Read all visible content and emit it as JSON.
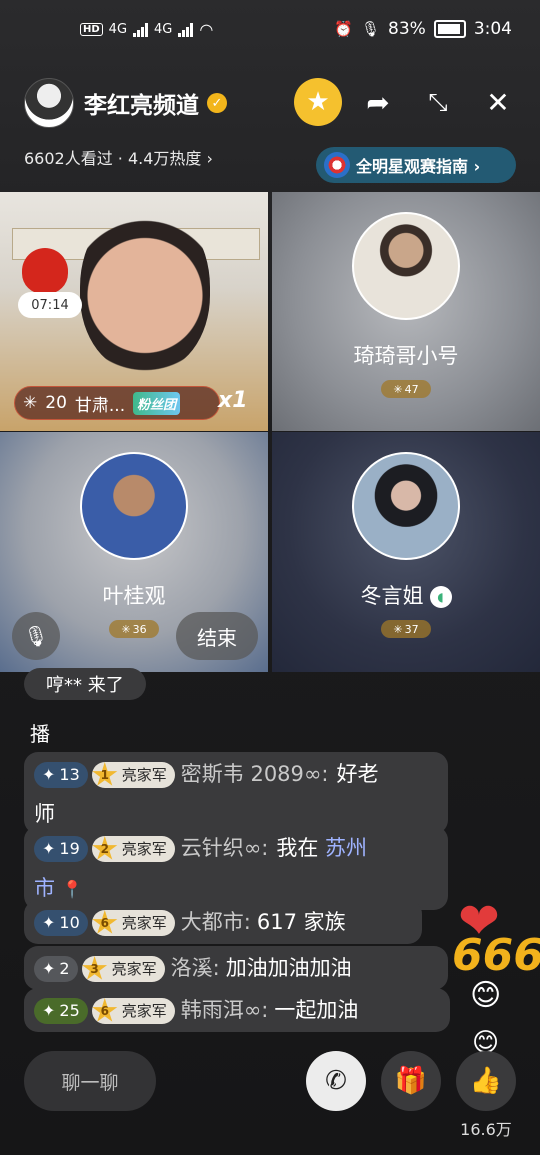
{
  "status": {
    "network": "HD",
    "sim1": "4G",
    "sim2": "4G",
    "battery": "83%",
    "time": "3:04"
  },
  "header": {
    "host_name": "李红亮频道",
    "stats": "6602人看过 · 4.4万热度 ›",
    "guide": "全明星观赛指南 ›"
  },
  "tiles": [
    {
      "timer": "07:14",
      "badge_level": "20",
      "user": "甘肃...",
      "fans_label": "粉丝团",
      "multiplier": "x1"
    },
    {
      "name": "琦琦哥小号",
      "heat": "47"
    },
    {
      "name": "叶桂观",
      "heat": "36",
      "end_label": "结束"
    },
    {
      "name": "冬言姐",
      "heat": "37"
    }
  ],
  "chat": {
    "join_text": "哼** 来了",
    "partial": "播",
    "messages": [
      {
        "level": "13",
        "fan_level": "1",
        "fan_name": "亮家军",
        "user": "密斯韦 2089∞:",
        "text1": "好老",
        "text2": "师"
      },
      {
        "level": "19",
        "fan_level": "2",
        "fan_name": "亮家军",
        "user": "云针织∞:",
        "text1": "我在",
        "link1": "苏州",
        "link2": "市"
      },
      {
        "level": "10",
        "fan_level": "6",
        "fan_name": "亮家军",
        "user": "大都市:",
        "text": "617 家族"
      },
      {
        "level": "2",
        "fan_level": "3",
        "fan_name": "亮家军",
        "user": "洛溪:",
        "text": "加油加油加油"
      },
      {
        "level": "25",
        "fan_level": "6",
        "fan_name": "亮家军",
        "user": "韩雨洱∞:",
        "text": "一起加油"
      }
    ]
  },
  "reactions": {
    "number": "666"
  },
  "bottom": {
    "chat_placeholder": "聊一聊",
    "like_count": "16.6万"
  }
}
